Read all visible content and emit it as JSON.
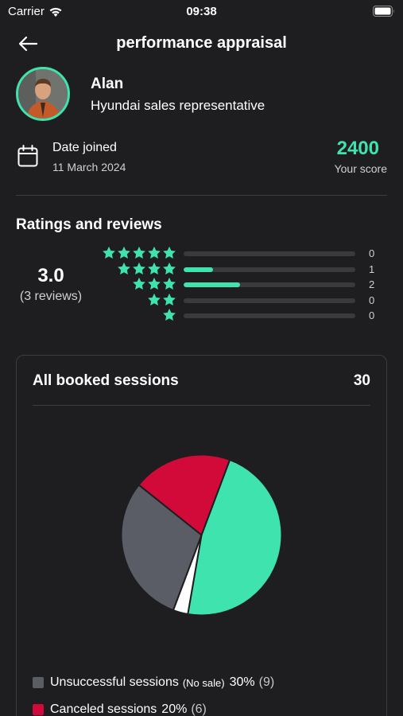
{
  "status_bar": {
    "carrier": "Carrier",
    "time": "09:38"
  },
  "header": {
    "title": "performance appraisal"
  },
  "profile": {
    "name": "Alan",
    "role": "Hyundai sales representative"
  },
  "joined": {
    "label": "Date joined",
    "date": "11 March 2024"
  },
  "score": {
    "value": "2400",
    "label": "Your score"
  },
  "ratings": {
    "title": "Ratings and reviews",
    "average": "3.0",
    "reviews": "(3 reviews)",
    "rows": [
      {
        "stars": 5,
        "count": "0",
        "fill": 0
      },
      {
        "stars": 4,
        "count": "1",
        "fill": 0.17
      },
      {
        "stars": 3,
        "count": "2",
        "fill": 0.33
      },
      {
        "stars": 2,
        "count": "0",
        "fill": 0
      },
      {
        "stars": 1,
        "count": "0",
        "fill": 0
      }
    ]
  },
  "sessions": {
    "title": "All booked sessions",
    "total": "30",
    "legend": [
      {
        "label": "Unsuccessful sessions",
        "note": "(No sale)",
        "percent": "30%",
        "count": "(9)"
      },
      {
        "label": "Canceled sessions",
        "note": "",
        "percent": "20%",
        "count": "(6)"
      }
    ]
  },
  "colors": {
    "accent": "#3fe3ae",
    "background": "#1e1e21",
    "unsuccessful": "#5a5d66",
    "canceled": "#d10a3a",
    "other": "#ffffff"
  },
  "chart_data": {
    "type": "pie",
    "slices": [
      {
        "percent": 47,
        "color": "#3fe3ae"
      },
      {
        "percent": 3,
        "color": "#ffffff"
      },
      {
        "percent": 30,
        "color": "#5a5d66"
      },
      {
        "percent": 20,
        "color": "#d10a3a"
      }
    ]
  }
}
